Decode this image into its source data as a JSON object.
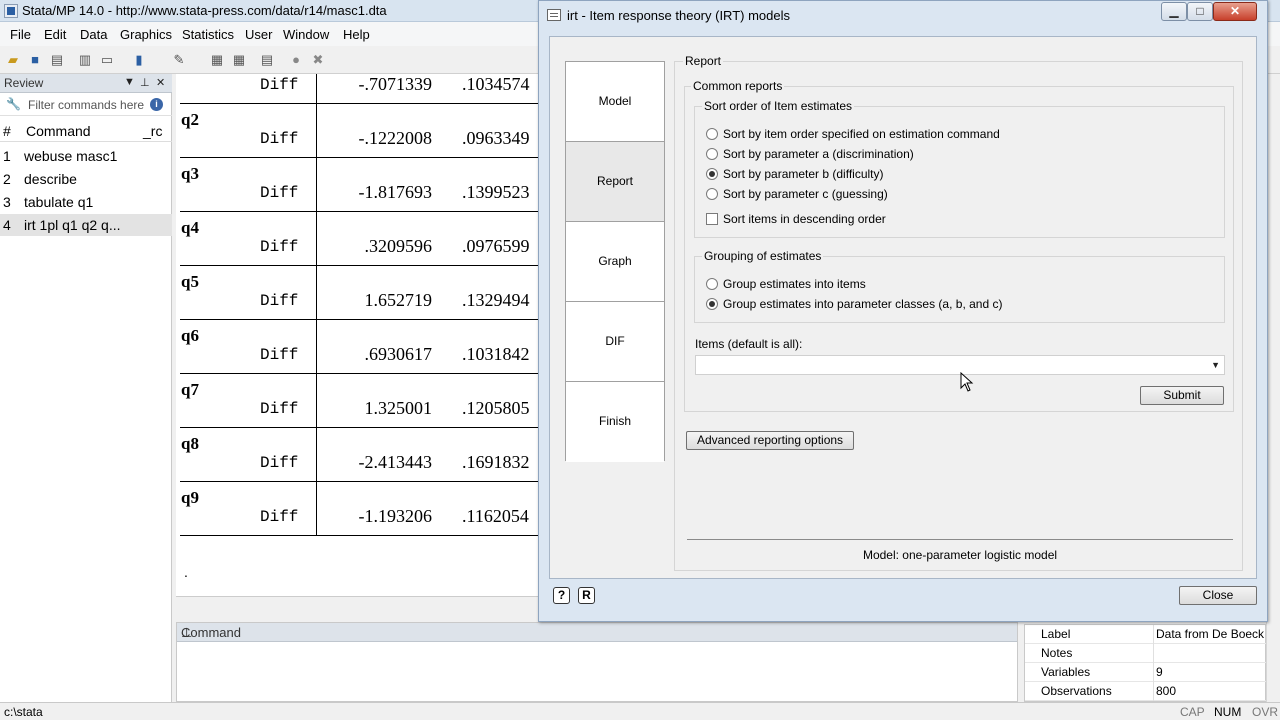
{
  "main_window": {
    "title": "Stata/MP 14.0 - http://www.stata-press.com/data/r14/masc1.dta",
    "menu": [
      "File",
      "Edit",
      "Data",
      "Graphics",
      "Statistics",
      "User",
      "Window",
      "Help"
    ]
  },
  "review": {
    "title": "Review",
    "filter_placeholder": "Filter commands here",
    "col_num": "#",
    "col_command": "Command",
    "col_rc": "_rc",
    "items": [
      {
        "n": "1",
        "cmd": "webuse masc1"
      },
      {
        "n": "2",
        "cmd": "describe"
      },
      {
        "n": "3",
        "cmd": "tabulate q1"
      },
      {
        "n": "4",
        "cmd": "irt 1pl q1 q2 q..."
      }
    ]
  },
  "results": {
    "first_row": {
      "label": "Diff",
      "coef": "-.7071339",
      "se": ".1034574"
    },
    "rows": [
      {
        "var": "q2",
        "label": "Diff",
        "coef": "-.1222008",
        "se": ".0963349"
      },
      {
        "var": "q3",
        "label": "Diff",
        "coef": "-1.817693",
        "se": ".1399523"
      },
      {
        "var": "q4",
        "label": "Diff",
        "coef": ".3209596",
        "se": ".0976599"
      },
      {
        "var": "q5",
        "label": "Diff",
        "coef": "1.652719",
        "se": ".1329494"
      },
      {
        "var": "q6",
        "label": "Diff",
        "coef": ".6930617",
        "se": ".1031842"
      },
      {
        "var": "q7",
        "label": "Diff",
        "coef": "1.325001",
        "se": ".1205805"
      },
      {
        "var": "q8",
        "label": "Diff",
        "coef": "-2.413443",
        "se": ".1691832"
      },
      {
        "var": "q9",
        "label": "Diff",
        "coef": "-1.193206",
        "se": ".1162054"
      }
    ],
    "prompt": "."
  },
  "command_panel": {
    "title": "Command"
  },
  "properties": [
    {
      "k": "Label",
      "v": "Data from De Boeck"
    },
    {
      "k": "Notes",
      "v": ""
    },
    {
      "k": "Variables",
      "v": "9"
    },
    {
      "k": "Observations",
      "v": "800"
    }
  ],
  "statusbar": {
    "path": "c:\\stata",
    "cap": "CAP",
    "num": "NUM",
    "ovr": "OVR"
  },
  "dialog": {
    "title": "irt - Item response theory (IRT) models",
    "tabs": [
      "Model",
      "Report",
      "Graph",
      "DIF",
      "Finish"
    ],
    "active_tab": "Report",
    "section_title": "Report",
    "common_reports": "Common reports",
    "sort_group_label": "Sort order of Item estimates",
    "sort_options": [
      "Sort by item order specified on estimation command",
      "Sort by parameter a (discrimination)",
      "Sort by parameter b (difficulty)",
      "Sort by parameter c (guessing)"
    ],
    "sort_selected": 2,
    "descending_label": "Sort items in descending order",
    "descending_checked": false,
    "grouping_label": "Grouping of estimates",
    "grouping_options": [
      "Group estimates into items",
      "Group estimates into parameter classes (a, b, and c)"
    ],
    "grouping_selected": 1,
    "items_label": "Items (default is all):",
    "items_value": "",
    "submit_label": "Submit",
    "advanced_label": "Advanced reporting options",
    "model_text": "Model: one-parameter logistic model",
    "close_label": "Close",
    "help_icon": "?",
    "reset_icon": "R"
  }
}
